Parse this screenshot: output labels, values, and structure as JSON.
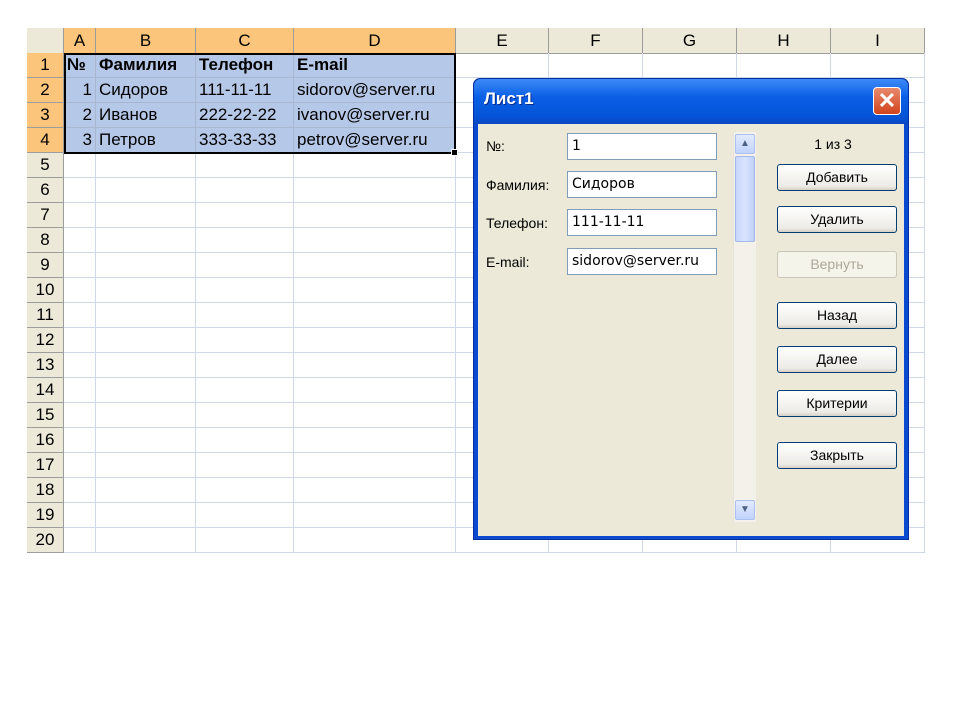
{
  "sheet": {
    "columns": [
      "A",
      "B",
      "C",
      "D",
      "E",
      "F",
      "G",
      "H",
      "I"
    ],
    "rows": [
      "1",
      "2",
      "3",
      "4",
      "5",
      "6",
      "7",
      "8",
      "9",
      "10",
      "11",
      "12",
      "13",
      "14",
      "15",
      "16",
      "17",
      "18",
      "19",
      "20"
    ],
    "header": [
      "№",
      "Фамилия",
      "Телефон",
      "E-mail"
    ],
    "records": [
      [
        "1",
        "Сидоров",
        "111-11-11",
        "sidorov@server.ru"
      ],
      [
        "2",
        "Иванов",
        "222-22-22",
        "ivanov@server.ru"
      ],
      [
        "3",
        "Петров",
        "333-33-33",
        "petrov@server.ru"
      ]
    ]
  },
  "dialog": {
    "title": "Лист1",
    "close_label": "✕",
    "fields": [
      {
        "label": "№:",
        "value": "1"
      },
      {
        "label": "Фамилия:",
        "value": "Сидоров"
      },
      {
        "label": "Телефон:",
        "value": "111-11-11"
      },
      {
        "label": "E-mail:",
        "value": "sidorov@server.ru"
      }
    ],
    "counter": "1 из 3",
    "buttons": {
      "add": "Добавить",
      "delete": "Удалить",
      "restore": "Вернуть",
      "prev": "Назад",
      "next": "Далее",
      "criteria": "Критерии",
      "close": "Закрыть"
    },
    "scroll_up_icon": "up-arrow",
    "scroll_down_icon": "down-arrow"
  },
  "colors": {
    "selected_header": "#fbc67c",
    "selected_cell": "#b6c8e8",
    "title_bar": "#0a5fe6"
  }
}
